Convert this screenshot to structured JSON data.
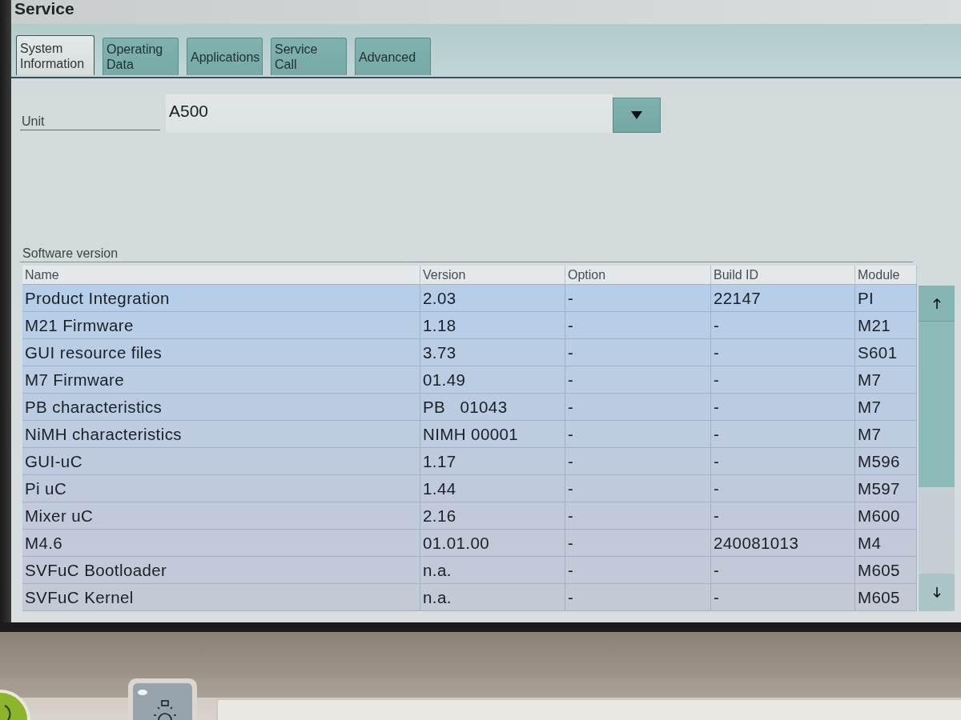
{
  "title": "Service",
  "tabs": [
    {
      "lines": [
        "System",
        "Information"
      ],
      "selected": true
    },
    {
      "lines": [
        "Operating",
        "Data"
      ],
      "selected": false
    },
    {
      "lines": [
        "Applications"
      ],
      "selected": false
    },
    {
      "lines": [
        "Service",
        "Call"
      ],
      "selected": false
    },
    {
      "lines": [
        "Advanced"
      ],
      "selected": false
    }
  ],
  "unit": {
    "label": "Unit",
    "value": "A500"
  },
  "software_version": {
    "title": "Software version",
    "columns": [
      "Name",
      "Version",
      "Option",
      "Build ID",
      "Module"
    ],
    "rows": [
      [
        "Product Integration",
        "2.03",
        "-",
        "22147",
        "PI"
      ],
      [
        "M21 Firmware",
        "1.18",
        "-",
        "-",
        "M21"
      ],
      [
        "GUI resource files",
        "3.73",
        "-",
        "-",
        "S601"
      ],
      [
        "M7 Firmware",
        "01.49",
        "-",
        "-",
        "M7"
      ],
      [
        "PB characteristics",
        "PB   01043",
        "-",
        "-",
        "M7"
      ],
      [
        "NiMH characteristics",
        "NIMH 00001",
        "-",
        "-",
        "M7"
      ],
      [
        "GUI-uC",
        "1.17",
        "-",
        "-",
        "M596"
      ],
      [
        "Pi uC",
        "1.44",
        "-",
        "-",
        "M597"
      ],
      [
        "Mixer uC",
        "2.16",
        "-",
        "-",
        "M600"
      ],
      [
        "M4.6",
        "01.01.00",
        "-",
        "240081013",
        "M4"
      ],
      [
        "SVFuC Bootloader",
        "n.a.",
        "-",
        "-",
        "M605"
      ],
      [
        "SVFuC Kernel",
        "n.a.",
        "-",
        "-",
        "M605"
      ]
    ]
  }
}
